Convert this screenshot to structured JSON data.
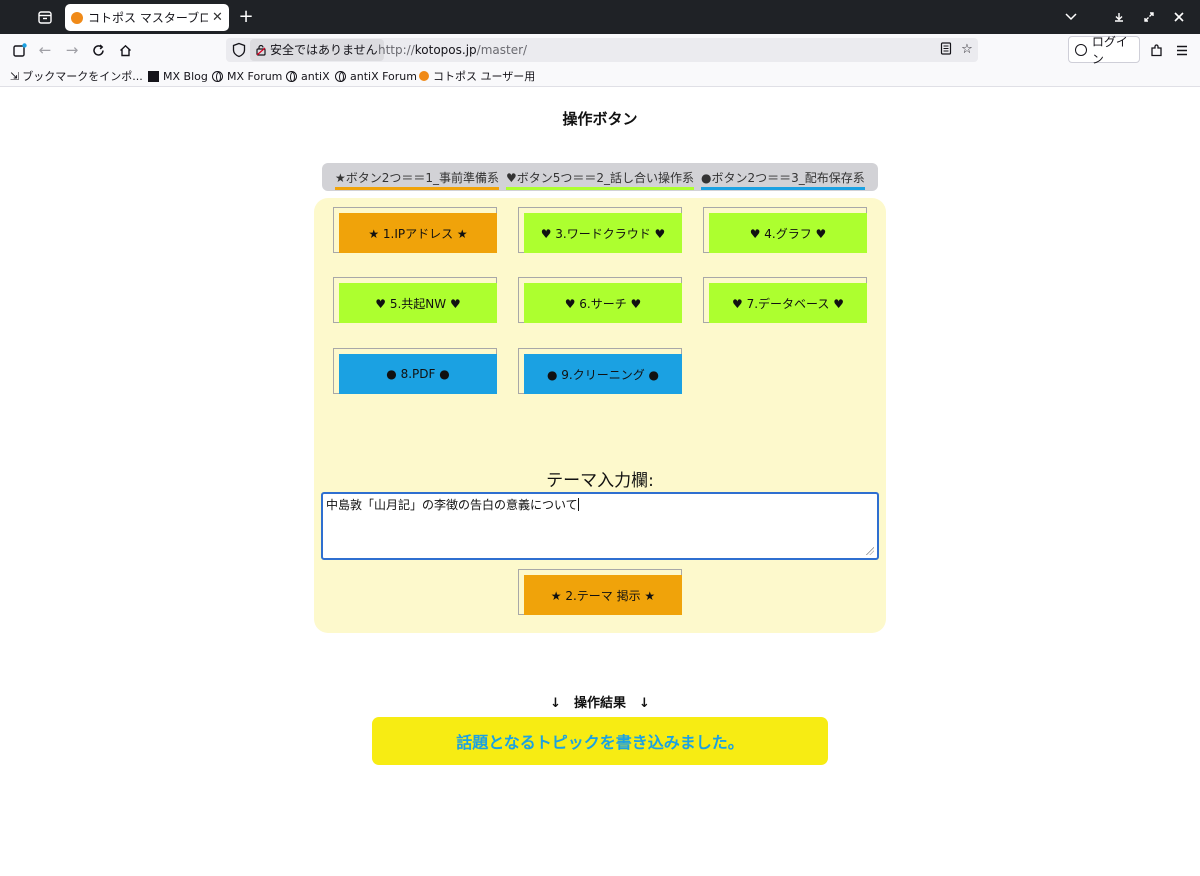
{
  "browser": {
    "tab": {
      "title": "コトポス マスターブログ: 操作画面"
    },
    "url": {
      "insecure_label": "安全ではありません",
      "host": "kotopos.jp",
      "path": "/master/",
      "scheme": "http://"
    },
    "login_label": "ログイン",
    "bookmarks": [
      {
        "label": "ブックマークをインポ...",
        "icon": "import-icon"
      },
      {
        "label": "MX Blog",
        "icon": "mx-logo-icon"
      },
      {
        "label": "MX Forum",
        "icon": "globe-icon"
      },
      {
        "label": "antiX",
        "icon": "globe-icon"
      },
      {
        "label": "antiX Forum",
        "icon": "globe-icon"
      },
      {
        "label": "コトポス ユーザー用",
        "icon": "kotopos-favicon-icon"
      }
    ]
  },
  "page": {
    "title": "操作ボタン",
    "legend": [
      {
        "label": "★ボタン2つ＝＝1_事前準備系",
        "color": "#f0a30a"
      },
      {
        "label": "♥ボタン5つ＝＝2_話し合い操作系",
        "color": "#adff2f"
      },
      {
        "label": "●ボタン2つ＝＝3_配布保存系",
        "color": "#1ba1e2"
      }
    ],
    "buttons": [
      {
        "label": "★ 1.IPアドレス ★",
        "color": "#f0a30a"
      },
      {
        "label": "♥ 3.ワードクラウド ♥",
        "color": "#adff2f"
      },
      {
        "label": "♥ 4.グラフ ♥",
        "color": "#adff2f"
      },
      {
        "label": "♥ 5.共起NW ♥",
        "color": "#adff2f"
      },
      {
        "label": "♥ 6.サーチ ♥",
        "color": "#adff2f"
      },
      {
        "label": "♥ 7.データベース ♥",
        "color": "#adff2f"
      },
      {
        "label": "● 8.PDF ●",
        "color": "#1ba1e2"
      },
      {
        "label": "● 9.クリーニング ●",
        "color": "#1ba1e2"
      }
    ],
    "theme_label": "テーマ入力欄:",
    "theme_value": "中島敦「山月記」の李徴の告白の意義について",
    "post_button": "★ 2.テーマ 掲示 ★",
    "result_label": "↓　操作結果　↓",
    "result_message": "話題となるトピックを書き込みました。"
  }
}
